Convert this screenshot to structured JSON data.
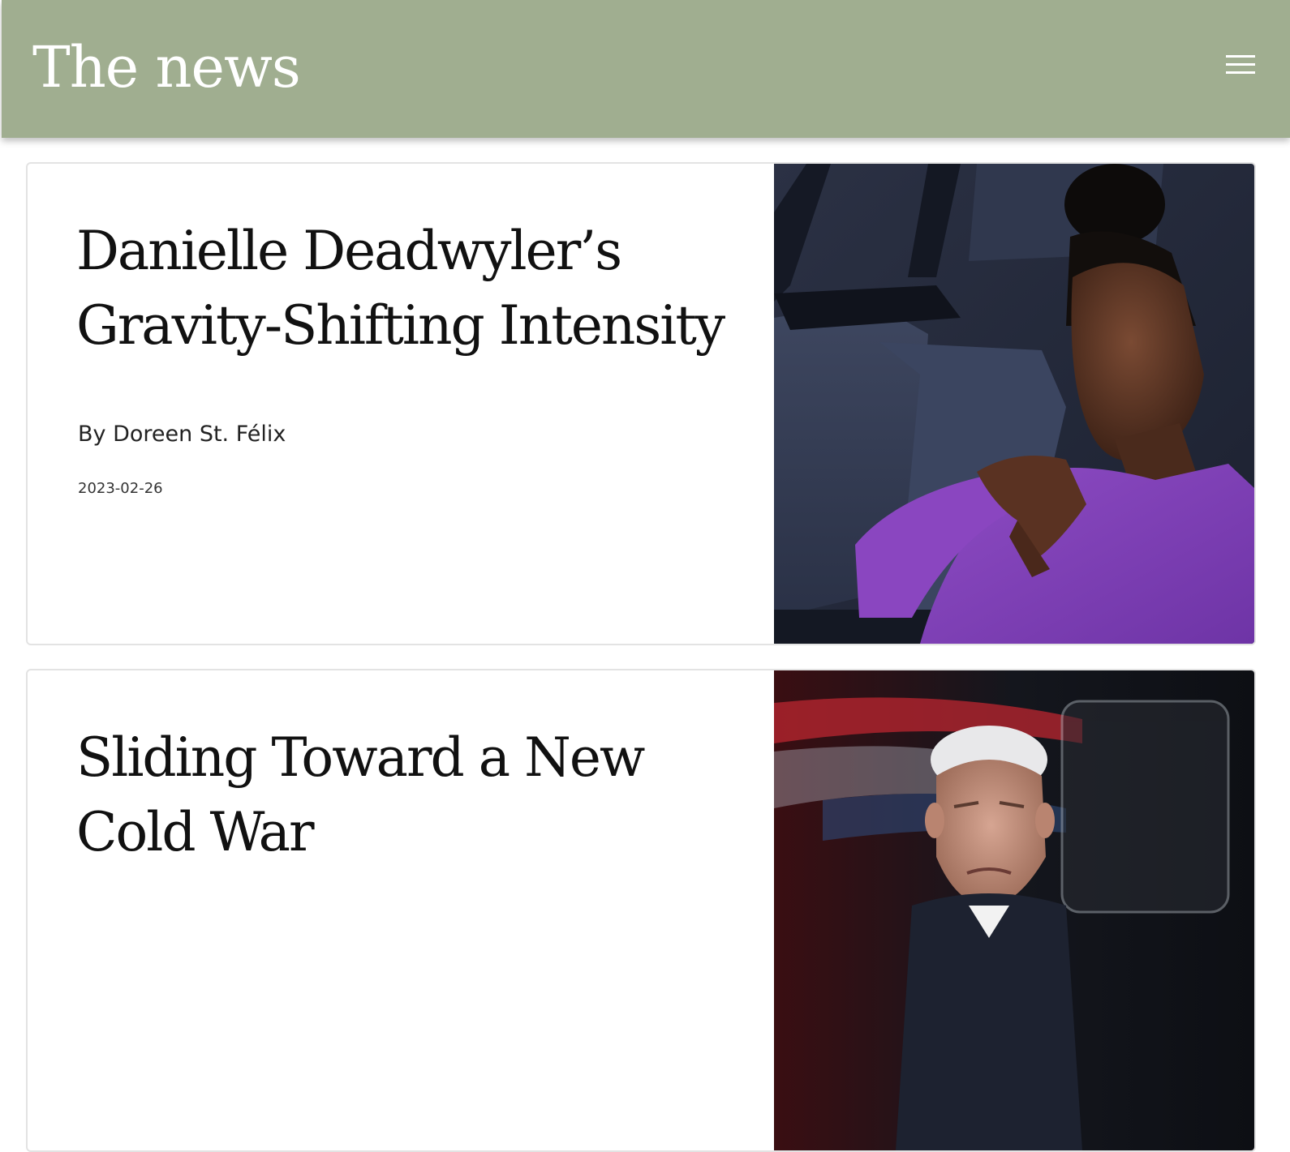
{
  "header": {
    "site_title": "The news",
    "menu_icon": "hamburger-menu-icon",
    "background_color": "#a0ae90"
  },
  "articles": [
    {
      "headline": "Danielle Deadwyler’s Gravity-Shifting Intensity",
      "byline": "By Doreen St. Félix",
      "date": "2023-02-26"
    },
    {
      "headline": "Sliding Toward a New Cold War"
    }
  ]
}
